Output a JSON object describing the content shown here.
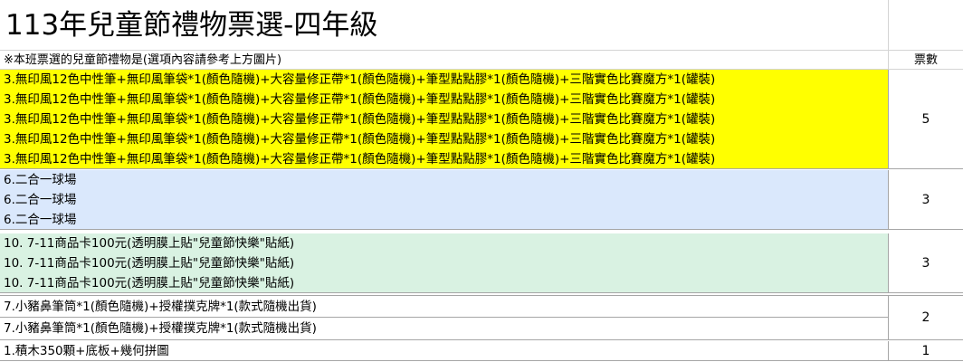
{
  "sheet": {
    "title": "113年兒童節禮物票選-四年級",
    "header_label": "※本班票選的兒童節禮物是(選項內容請參考上方圖片)",
    "header_count": "票數"
  },
  "groups": [
    {
      "color": "#ffff00",
      "items": [
        "3.無印風12色中性筆+無印風筆袋*1(顏色隨機)+大容量修正帶*1(顏色隨機)+筆型點點膠*1(顏色隨機)+三階實色比賽魔方*1(罐裝)",
        "3.無印風12色中性筆+無印風筆袋*1(顏色隨機)+大容量修正帶*1(顏色隨機)+筆型點點膠*1(顏色隨機)+三階實色比賽魔方*1(罐裝)",
        "3.無印風12色中性筆+無印風筆袋*1(顏色隨機)+大容量修正帶*1(顏色隨機)+筆型點點膠*1(顏色隨機)+三階實色比賽魔方*1(罐裝)",
        "3.無印風12色中性筆+無印風筆袋*1(顏色隨機)+大容量修正帶*1(顏色隨機)+筆型點點膠*1(顏色隨機)+三階實色比賽魔方*1(罐裝)",
        "3.無印風12色中性筆+無印風筆袋*1(顏色隨機)+大容量修正帶*1(顏色隨機)+筆型點點膠*1(顏色隨機)+三階實色比賽魔方*1(罐裝)"
      ],
      "count": "5"
    },
    {
      "color": "#dae8fc",
      "items": [
        "6.二合一球場",
        "6.二合一球場",
        "6.二合一球場"
      ],
      "count": "3"
    },
    {
      "color": "#d9f2e2",
      "items": [
        "10. 7-11商品卡100元(透明膜上貼\"兒童節快樂\"貼紙)",
        "10. 7-11商品卡100元(透明膜上貼\"兒童節快樂\"貼紙)",
        "10. 7-11商品卡100元(透明膜上貼\"兒童節快樂\"貼紙)"
      ],
      "count": "3"
    },
    {
      "color": "#ffffff",
      "items": [
        "7.小豬鼻筆筒*1(顏色隨機)+授權撲克牌*1(款式隨機出貨)",
        "7.小豬鼻筆筒*1(顏色隨機)+授權撲克牌*1(款式隨機出貨)"
      ],
      "count": "2"
    },
    {
      "color": "#ffffff",
      "items": [
        "1.積木350顆+底板+幾何拼圖"
      ],
      "count": "1"
    }
  ]
}
